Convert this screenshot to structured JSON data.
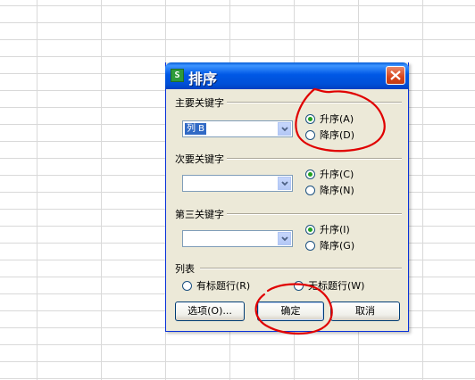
{
  "dialog": {
    "title": "排序",
    "app_icon_letter": "S",
    "primary_key": {
      "label": "主要关键字",
      "value": "列 B",
      "ascending": "升序(A)",
      "descending": "降序(D)"
    },
    "secondary_key": {
      "label": "次要关键字",
      "value": "",
      "ascending": "升序(C)",
      "descending": "降序(N)"
    },
    "third_key": {
      "label": "第三关键字",
      "value": "",
      "ascending": "升序(I)",
      "descending": "降序(G)"
    },
    "list": {
      "label": "列表",
      "has_header": "有标题行(R)",
      "no_header": "无标题行(W)"
    },
    "buttons": {
      "options": "选项(O)...",
      "ok": "确定",
      "cancel": "取消"
    }
  },
  "colors": {
    "titlebar": "#0058e6",
    "dialog_bg": "#ece9d8",
    "selection": "#316ac5",
    "annotation": "#e00000"
  }
}
